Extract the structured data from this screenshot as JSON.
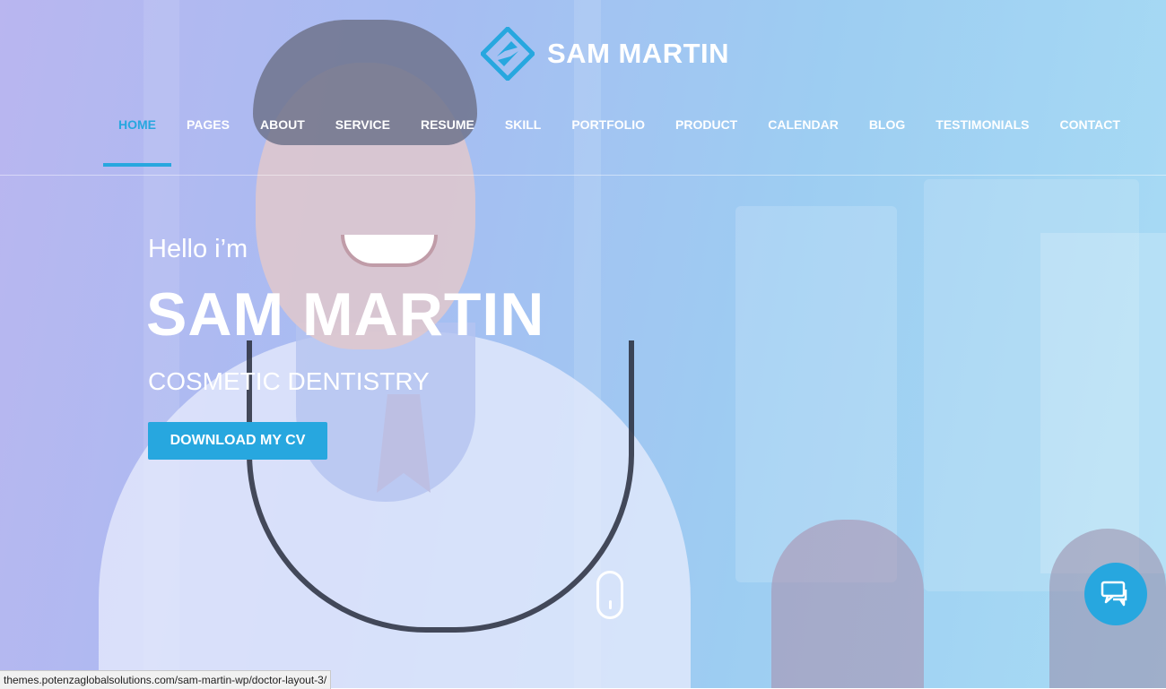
{
  "brand": {
    "name": "SAM MARTIN",
    "logo_icon": "diamond-logo-icon",
    "accent_color": "#27a7df"
  },
  "nav": {
    "items": [
      {
        "label": "HOME",
        "active": true
      },
      {
        "label": "PAGES"
      },
      {
        "label": "ABOUT"
      },
      {
        "label": "SERVICE"
      },
      {
        "label": "RESUME"
      },
      {
        "label": "SKILL"
      },
      {
        "label": "PORTFOLIO"
      },
      {
        "label": "PRODUCT"
      },
      {
        "label": "CALENDAR"
      },
      {
        "label": "BLOG"
      },
      {
        "label": "TESTIMONIALS"
      },
      {
        "label": "CONTACT"
      }
    ]
  },
  "hero": {
    "greeting": "Hello i’m",
    "name": "SAM MARTIN",
    "title": "COSMETIC DENTISTRY",
    "cta_label": "DOWNLOAD MY CV"
  },
  "chat": {
    "icon": "chat-bubbles-icon"
  },
  "status_bar": {
    "url": "themes.potenzaglobalsolutions.com/sam-martin-wp/doctor-layout-3/"
  }
}
